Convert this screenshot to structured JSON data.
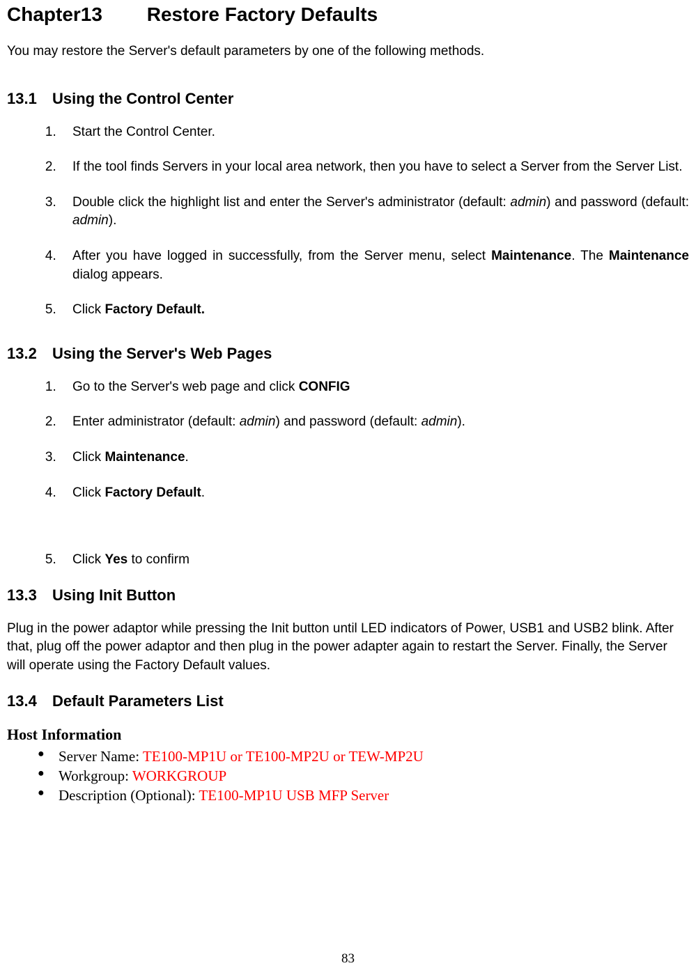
{
  "chapter": {
    "number": "Chapter13",
    "title": "Restore Factory Defaults"
  },
  "intro": "You may restore the Server's default parameters by one of the following methods.",
  "s131": {
    "num": "13.1",
    "title": "Using the Control Center"
  },
  "steps131": {
    "s1": "Start the Control Center.",
    "s2": "If the tool finds Servers in your local area network, then you have to select a Server from the Server List.",
    "s3a": "Double click the highlight list and enter the Server's administrator (default: ",
    "s3b": "admin",
    "s3c": ") and password (default: ",
    "s3d": "admin",
    "s3e": ").",
    "s4a": "After you have logged in successfully, from the Server menu, select ",
    "s4b": "Maintenance",
    "s4c": ". The ",
    "s4d": "Maintenance",
    "s4e": " dialog appears.",
    "s5a": "Click ",
    "s5b": "Factory Default."
  },
  "s132": {
    "num": "13.2",
    "title": "Using the Server's Web Pages"
  },
  "steps132": {
    "s1a": "Go to the Server's web page and click ",
    "s1b": "CONFIG",
    "s2a": "Enter administrator (default: ",
    "s2b": "admin",
    "s2c": ") and password (default: ",
    "s2d": "admin",
    "s2e": ").",
    "s3a": "Click ",
    "s3b": "Maintenance",
    "s3c": ".",
    "s4a": "Click ",
    "s4b": "Factory Default",
    "s4c": ".",
    "s5a": "Click ",
    "s5b": "Yes",
    "s5c": " to confirm"
  },
  "s133": {
    "num": "13.3",
    "title": "Using Init Button"
  },
  "body133": "Plug in the power adaptor while pressing the Init button until LED indicators of Power, USB1 and USB2 blink.   After that, plug off the power adaptor and then plug in the power adapter again to restart the Server. Finally, the Server will operate using the Factory Default values.",
  "s134": {
    "num": "13.4",
    "title": "Default Parameters List"
  },
  "hostinfo": {
    "heading": "Host Information",
    "l1a": "Server Name: ",
    "l1b": "TE100-MP1U or TE100-MP2U or TEW-MP2U",
    "l2a": "Workgroup: ",
    "l2b": "WORKGROUP",
    "l3a": "Description (Optional): ",
    "l3b": "TE100-MP1U USB MFP Server"
  },
  "pagenum": "83"
}
